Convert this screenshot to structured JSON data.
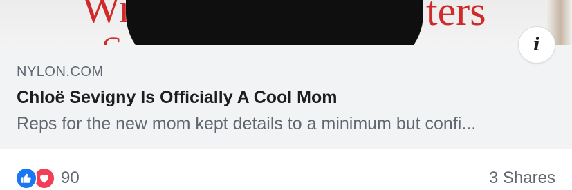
{
  "link_preview": {
    "source": "NYLON.COM",
    "headline": "Chloë Sevigny Is Officially A Cool Mom",
    "description": "Reps for the new mom kept details to a minimum but confi...",
    "info_icon": "info-icon"
  },
  "footer": {
    "reaction_icons": [
      "like-icon",
      "love-icon"
    ],
    "reaction_count": "90",
    "shares": "3 Shares"
  },
  "colors": {
    "like": "#1877f2",
    "love": "#f33e58",
    "meta_text": "#606770",
    "title_text": "#1c1e21",
    "card_bg": "#f2f3f5"
  }
}
